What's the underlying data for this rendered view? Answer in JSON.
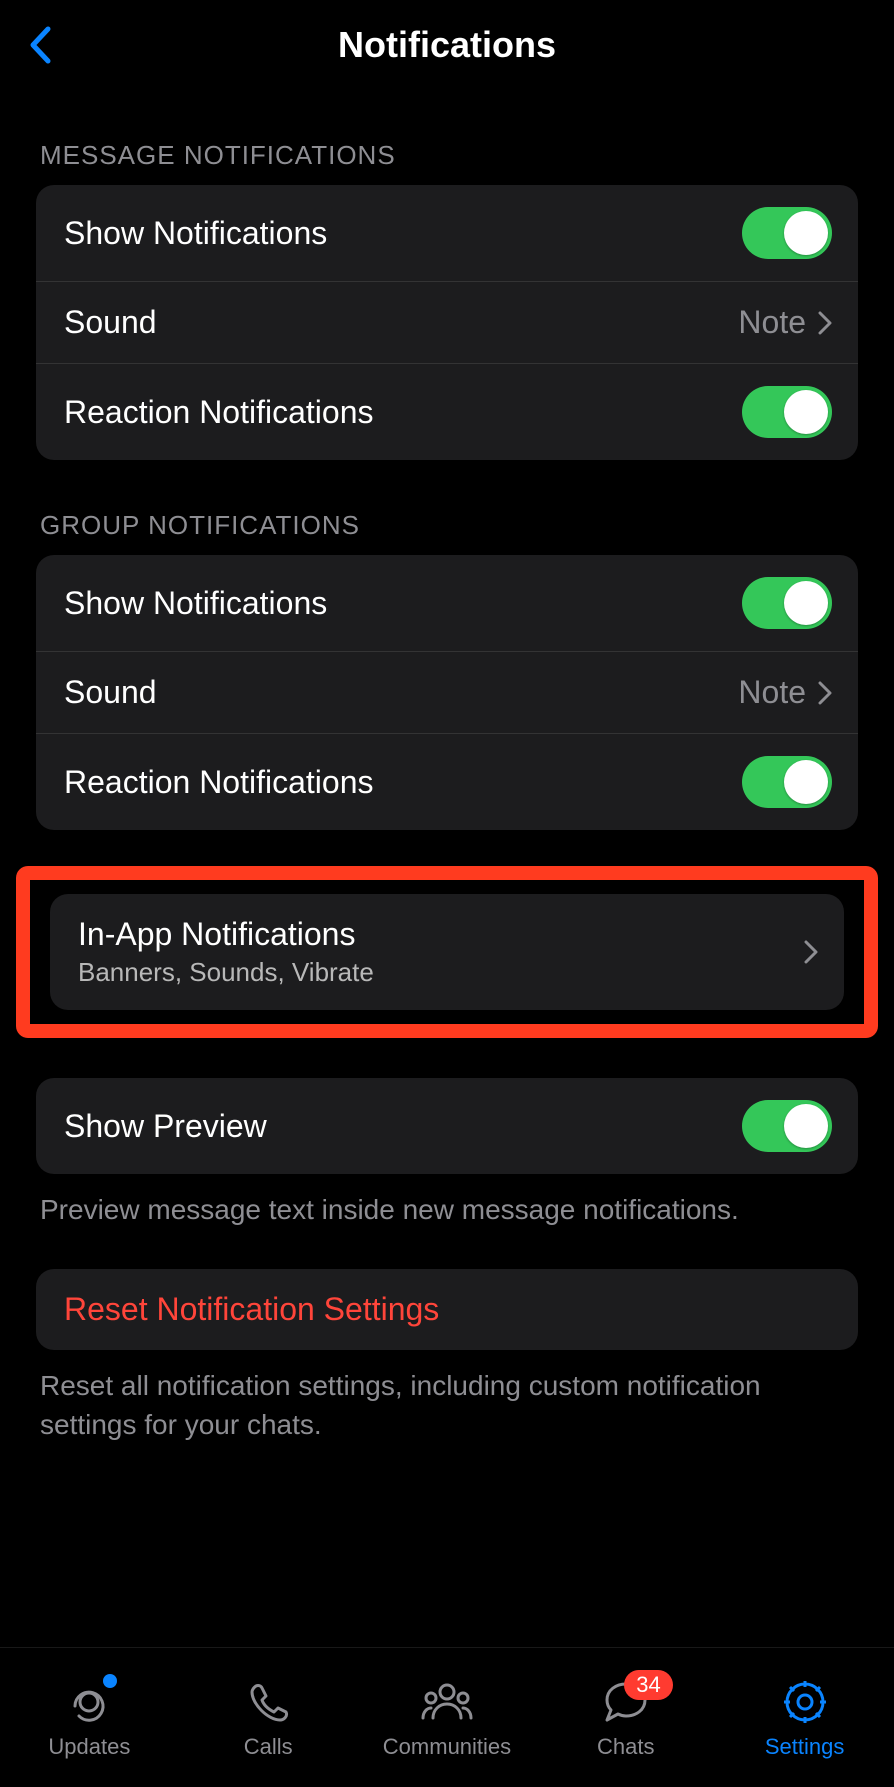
{
  "header": {
    "title": "Notifications"
  },
  "sections": {
    "message": {
      "header": "MESSAGE NOTIFICATIONS",
      "showNotifications": "Show Notifications",
      "sound": "Sound",
      "soundValue": "Note",
      "reaction": "Reaction Notifications"
    },
    "group": {
      "header": "GROUP NOTIFICATIONS",
      "showNotifications": "Show Notifications",
      "sound": "Sound",
      "soundValue": "Note",
      "reaction": "Reaction Notifications"
    },
    "inApp": {
      "title": "In-App Notifications",
      "subtitle": "Banners, Sounds, Vibrate"
    },
    "preview": {
      "title": "Show Preview",
      "footer": "Preview message text inside new message notifications."
    },
    "reset": {
      "title": "Reset Notification Settings",
      "footer": "Reset all notification settings, including custom notification settings for your chats."
    }
  },
  "tabs": {
    "updates": "Updates",
    "calls": "Calls",
    "communities": "Communities",
    "chats": "Chats",
    "chatsBadge": "34",
    "settings": "Settings"
  }
}
